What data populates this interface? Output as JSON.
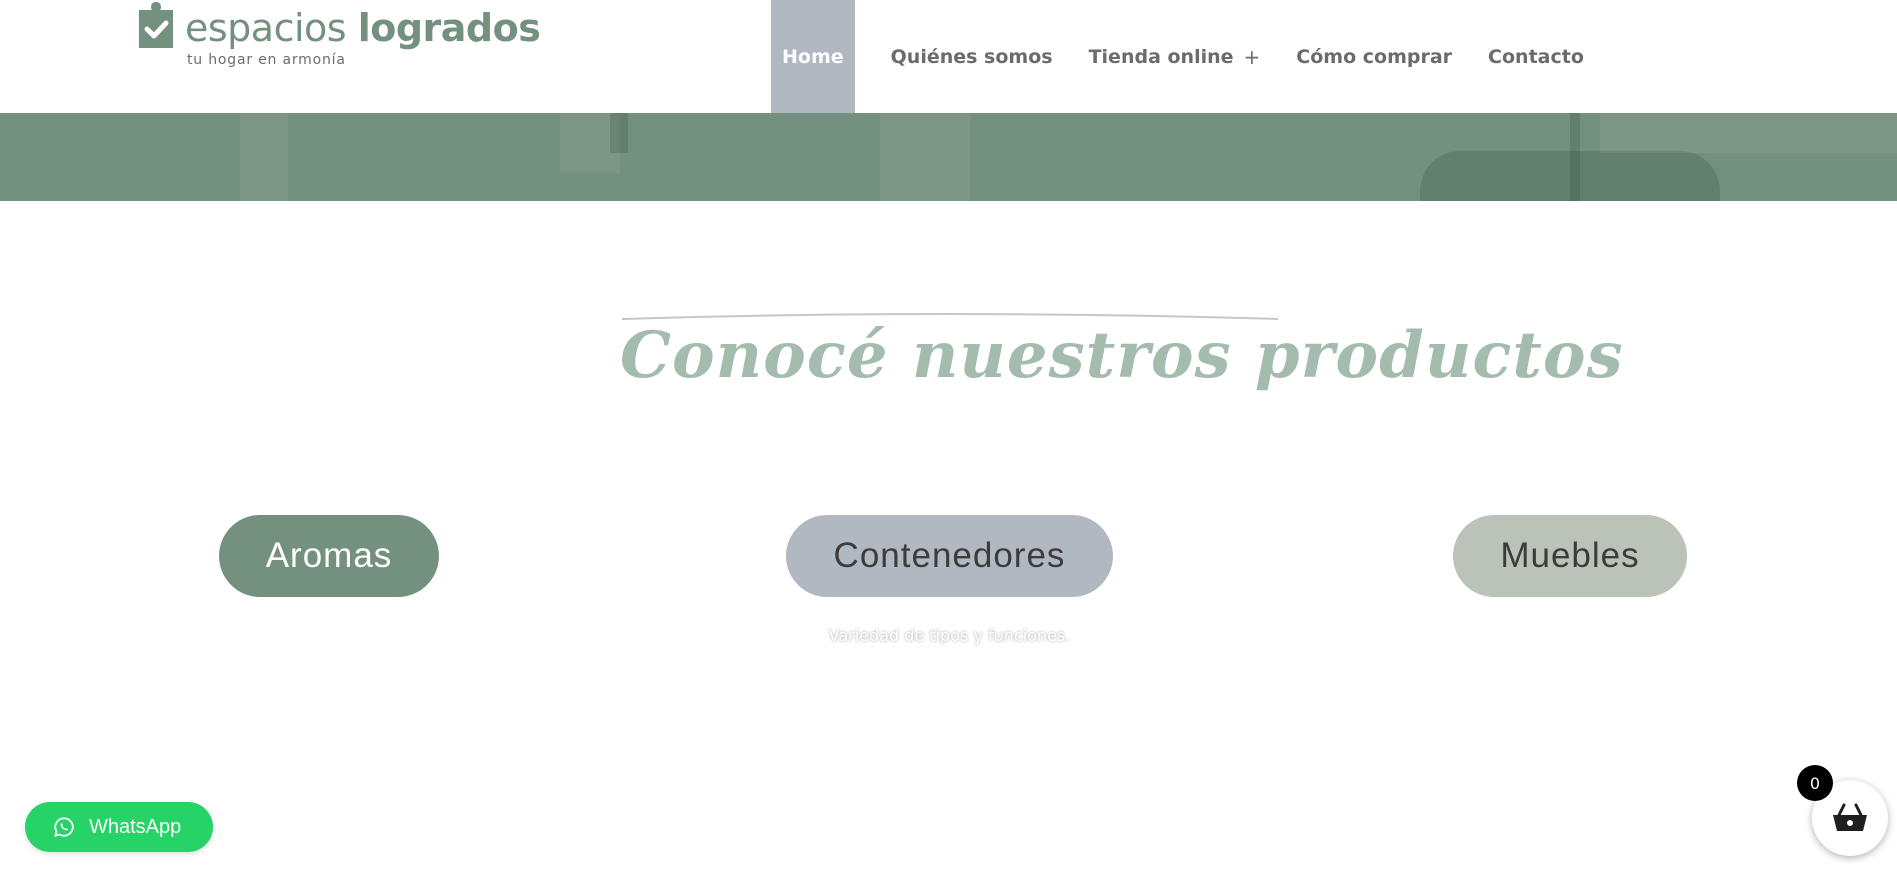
{
  "header": {
    "logo": {
      "word_light": "espacios",
      "word_bold": "logrados",
      "tagline": "tu hogar en armonía"
    },
    "nav": [
      {
        "label": "Home",
        "active": true
      },
      {
        "label": "Quiénes somos"
      },
      {
        "label": "Tienda online",
        "has_submenu": true,
        "submenu_glyph": "+"
      },
      {
        "label": "Cómo comprar"
      },
      {
        "label": "Contacto"
      }
    ]
  },
  "section": {
    "heading": "Conocé nuestros productos",
    "categories": [
      {
        "label": "Aromas"
      },
      {
        "label": "Contenedores",
        "subtext": "Variedad de tipos y funciones."
      },
      {
        "label": "Muebles"
      }
    ]
  },
  "whatsapp": {
    "label": "WhatsApp"
  },
  "cart": {
    "count": "0"
  },
  "colors": {
    "brand_green": "#74917f",
    "nav_active_bg": "#b2b8c1",
    "heading": "#a4bcae",
    "pill_grey": "#b2b8c1",
    "pill_sage": "#bbc2b8",
    "whatsapp": "#25d366"
  },
  "icons": [
    "location-check-icon",
    "whatsapp-icon",
    "basket-icon"
  ]
}
